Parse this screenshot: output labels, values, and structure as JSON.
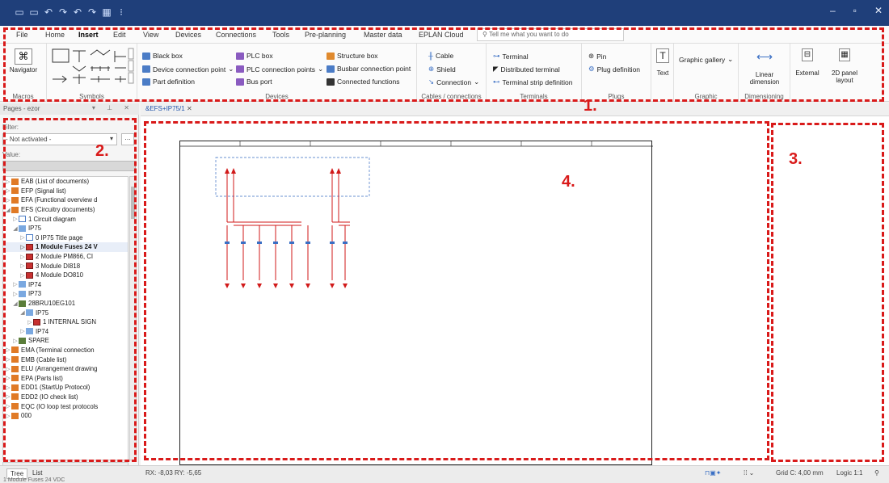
{
  "menu": {
    "tabs": [
      "File",
      "Home",
      "Insert",
      "Edit",
      "View",
      "Devices",
      "Connections",
      "Tools",
      "Pre-planning",
      "Master data",
      "EPLAN Cloud"
    ],
    "active_tab": "Insert",
    "tell_me_placeholder": "Tell me what you want to do"
  },
  "ribbon": {
    "macros": {
      "navigator": "Navigator",
      "label": "Macros"
    },
    "symbols": {
      "label": "Symbols"
    },
    "devices": {
      "label": "Devices",
      "black_box": "Black box",
      "device_connection_point": "Device connection point",
      "part_definition": "Part definition",
      "plc_box": "PLC box",
      "plc_connection_points": "PLC connection points",
      "bus_port": "Bus port",
      "structure_box": "Structure box",
      "busbar_connection_point": "Busbar connection point",
      "connected_functions": "Connected functions"
    },
    "cables": {
      "label": "Cables / connections",
      "cable": "Cable",
      "shield": "Shield",
      "connection": "Connection"
    },
    "terminals": {
      "label": "Terminals",
      "terminal": "Terminal",
      "distributed_terminal": "Distributed terminal",
      "terminal_strip_definition": "Terminal strip definition"
    },
    "plugs": {
      "label": "Plugs",
      "pin": "Pin",
      "plug_definition": "Plug definition"
    },
    "text": {
      "label": "Text"
    },
    "graphic": {
      "gallery": "Graphic gallery",
      "label": "Graphic"
    },
    "dimensioning": {
      "linear": "Linear dimension",
      "label": "Dimensioning"
    },
    "external": "External",
    "panel_layout": "2D panel layout"
  },
  "annotations": [
    "1.",
    "2.",
    "3.",
    "4."
  ],
  "left_panel": {
    "title": "Pages - ezor",
    "filter_label": "Filter:",
    "filter_value": "- Not activated -",
    "value_label": "Value:",
    "tree": [
      {
        "indent": 1,
        "icon": "orange",
        "label": "EAB (List of documents)"
      },
      {
        "indent": 1,
        "icon": "orange",
        "label": "EFP (Signal list)"
      },
      {
        "indent": 1,
        "icon": "orange",
        "label": "EFA (Functional overview d"
      },
      {
        "indent": 1,
        "icon": "orange",
        "label": "EFS (Circuitry documents)",
        "expanded": true
      },
      {
        "indent": 2,
        "icon": "page",
        "label": "1 Circuit diagram"
      },
      {
        "indent": 2,
        "icon": "blue",
        "label": "IP75",
        "expanded": true
      },
      {
        "indent": 3,
        "icon": "page",
        "label": "0 IP75 Title page"
      },
      {
        "indent": 3,
        "icon": "pagered",
        "label": "1 Module Fuses 24 V",
        "selected": true
      },
      {
        "indent": 3,
        "icon": "pagered",
        "label": "2 Module PM866, CI"
      },
      {
        "indent": 3,
        "icon": "pagered",
        "label": "3 Module DI818"
      },
      {
        "indent": 3,
        "icon": "pagered",
        "label": "4 Module DO810"
      },
      {
        "indent": 2,
        "icon": "blue",
        "label": "IP74"
      },
      {
        "indent": 2,
        "icon": "blue",
        "label": "IP73"
      },
      {
        "indent": 2,
        "icon": "green",
        "label": "28BRU10EG101",
        "expanded": true
      },
      {
        "indent": 3,
        "icon": "blue",
        "label": "IP75",
        "expanded": true
      },
      {
        "indent": 4,
        "icon": "pagered",
        "label": "1 INTERNAL SIGN"
      },
      {
        "indent": 3,
        "icon": "blue",
        "label": "IP74"
      },
      {
        "indent": 2,
        "icon": "green",
        "label": "SPARE"
      },
      {
        "indent": 1,
        "icon": "orange",
        "label": "EMA (Terminal connection"
      },
      {
        "indent": 1,
        "icon": "orange",
        "label": "EMB (Cable list)"
      },
      {
        "indent": 1,
        "icon": "orange",
        "label": "ELU (Arrangement drawing"
      },
      {
        "indent": 1,
        "icon": "orange",
        "label": "EPA (Parts list)"
      },
      {
        "indent": 1,
        "icon": "orange",
        "label": "EDD1 (StartUp Protocol)"
      },
      {
        "indent": 1,
        "icon": "orange",
        "label": "EDD2 (IO check list)"
      },
      {
        "indent": 1,
        "icon": "orange",
        "label": "EQC (IO loop test protocols"
      },
      {
        "indent": 1,
        "icon": "orange",
        "label": "000"
      }
    ]
  },
  "document_tab": "&EFS+IP75/1",
  "status": {
    "tab_tree": "Tree",
    "tab_list": "List",
    "coords": "RX: -8,03 RY: -5,65",
    "grid": "Grid C: 4,00 mm",
    "logic": "Logic 1:1",
    "footer_text": "1 Module Fuses 24 VDC"
  },
  "colors": {
    "titlebar": "#1f3f7a",
    "annotation_red": "#d91a1a",
    "schematic_red": "#d11a1a",
    "schematic_blue": "#3a6fc4"
  }
}
